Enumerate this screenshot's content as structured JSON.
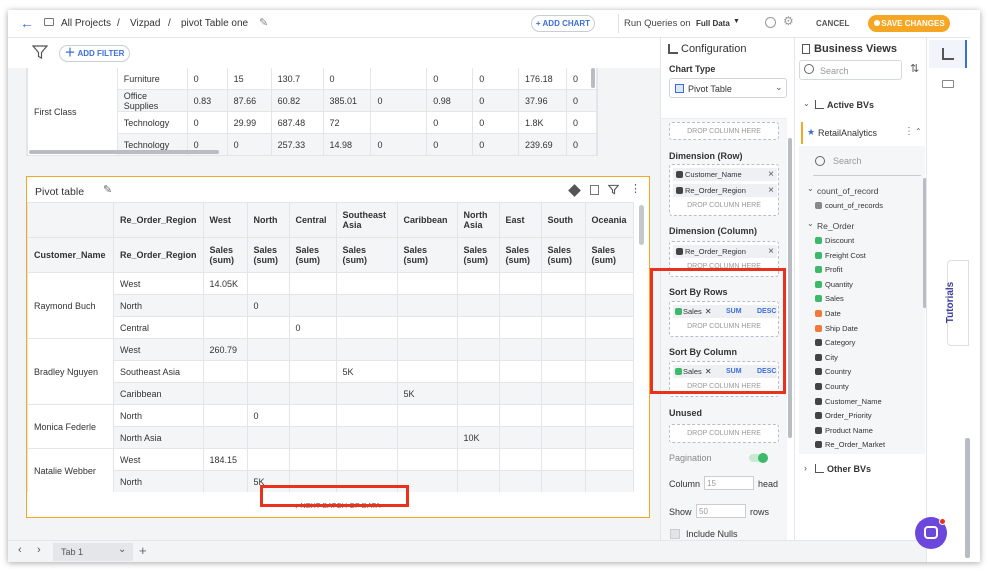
{
  "topbar": {
    "breadcrumb": [
      "All Projects",
      "Vizpad",
      "pivot Table one"
    ],
    "add_chart": "+ ADD CHART",
    "run_queries_label": "Run Queries on",
    "run_queries_value": "Full Data",
    "cancel": "CANCEL",
    "save_changes": "SAVE CHANGES"
  },
  "filterbar": {
    "add_filter": "ADD FILTER"
  },
  "upper_table": {
    "row_group": "First Class",
    "rows": [
      [
        "Furniture",
        "0",
        "15",
        "130.7",
        "0",
        "",
        "0",
        "0",
        "176.18",
        "0"
      ],
      [
        "Office Supplies",
        "0.83",
        "87.66",
        "60.82",
        "385.01",
        "0",
        "0.98",
        "0",
        "37.96",
        "0"
      ],
      [
        "Technology",
        "0",
        "29.99",
        "687.48",
        "72",
        "",
        "0",
        "0",
        "1.8K",
        "0"
      ],
      [
        "Technology",
        "0",
        "0",
        "257.33",
        "14.98",
        "0",
        "0",
        "0",
        "239.69",
        "0"
      ]
    ]
  },
  "pivot": {
    "title": "Pivot table",
    "header_row1": [
      "",
      "Re_Order_Region",
      "West",
      "North",
      "Central",
      "Southeast Asia",
      "Caribbean",
      "North Asia",
      "East",
      "South",
      "Oceania"
    ],
    "header_row2": [
      "Customer_Name",
      "Re_Order_Region",
      "Sales (sum)",
      "Sales (sum)",
      "Sales (sum)",
      "Sales (sum)",
      "Sales (sum)",
      "Sales (sum)",
      "Sales (sum)",
      "Sales (sum)",
      "Sales (sum)"
    ],
    "groups": [
      {
        "name": "Raymond Buch",
        "rows": [
          {
            "region": "West",
            "vals": [
              "14.05K",
              "",
              "",
              "",
              "",
              "",
              "",
              "",
              ""
            ]
          },
          {
            "region": "North",
            "vals": [
              "",
              "0",
              "",
              "",
              "",
              "",
              "",
              "",
              ""
            ]
          },
          {
            "region": "Central",
            "vals": [
              "",
              "",
              "0",
              "",
              "",
              "",
              "",
              "",
              ""
            ]
          }
        ]
      },
      {
        "name": "Bradley Nguyen",
        "rows": [
          {
            "region": "West",
            "vals": [
              "260.79",
              "",
              "",
              "",
              "",
              "",
              "",
              "",
              ""
            ]
          },
          {
            "region": "Southeast Asia",
            "vals": [
              "",
              "",
              "",
              "5K",
              "",
              "",
              "",
              "",
              ""
            ]
          },
          {
            "region": "Caribbean",
            "vals": [
              "",
              "",
              "",
              "",
              "5K",
              "",
              "",
              "",
              ""
            ]
          }
        ]
      },
      {
        "name": "Monica Federle",
        "rows": [
          {
            "region": "North",
            "vals": [
              "",
              "0",
              "",
              "",
              "",
              "",
              "",
              "",
              ""
            ]
          },
          {
            "region": "North Asia",
            "vals": [
              "",
              "",
              "",
              "",
              "",
              "10K",
              "",
              "",
              ""
            ]
          }
        ]
      },
      {
        "name": "Natalie Webber",
        "rows": [
          {
            "region": "West",
            "vals": [
              "184.15",
              "",
              "",
              "",
              "",
              "",
              "",
              "",
              ""
            ]
          },
          {
            "region": "North",
            "vals": [
              "",
              "5K",
              "",
              "",
              "",
              "",
              "",
              "",
              ""
            ]
          }
        ]
      }
    ],
    "next_batch": "↓ NEXT BATCH OF DATA"
  },
  "config": {
    "title": "Configuration",
    "chart_type_label": "Chart Type",
    "chart_type_value": "Pivot Table",
    "drop_column": "DROP COLUMN HERE",
    "dimension_row_label": "Dimension (Row)",
    "dimension_row_chips": [
      "Customer_Name",
      "Re_Order_Region"
    ],
    "dimension_col_label": "Dimension (Column)",
    "dimension_col_chips": [
      "Re_Order_Region"
    ],
    "sort_rows_label": "Sort By Rows",
    "sort_col_label": "Sort By Column",
    "sort_chip": "Sales",
    "sum": "SUM",
    "desc": "DESC",
    "unused_label": "Unused",
    "pagination_label": "Pagination",
    "column_label": "Column",
    "column_value": "15",
    "column_suffix": "head",
    "show_label": "Show",
    "show_value": "50",
    "show_suffix": "rows",
    "include_nulls": "Include Nulls"
  },
  "business_views": {
    "title": "Business Views",
    "search_placeholder": "Search",
    "active_bvs": "Active BVs",
    "bv_name": "RetailAnalytics",
    "inner_search": "Search",
    "group1": "count_of_record",
    "group1_items": [
      "count_of_records"
    ],
    "group2": "Re_Order",
    "group2_items": [
      {
        "name": "Discount",
        "color": "#3cb96a"
      },
      {
        "name": "Freight Cost",
        "color": "#3cb96a"
      },
      {
        "name": "Profit",
        "color": "#3cb96a"
      },
      {
        "name": "Quantity",
        "color": "#3cb96a"
      },
      {
        "name": "Sales",
        "color": "#3cb96a"
      },
      {
        "name": "Date",
        "color": "#f07a3c"
      },
      {
        "name": "Ship Date",
        "color": "#f07a3c"
      },
      {
        "name": "Category",
        "color": "#444444"
      },
      {
        "name": "City",
        "color": "#444444"
      },
      {
        "name": "Country",
        "color": "#444444"
      },
      {
        "name": "County",
        "color": "#444444"
      },
      {
        "name": "Customer_Name",
        "color": "#444444"
      },
      {
        "name": "Order_Priority",
        "color": "#444444"
      },
      {
        "name": "Product Name",
        "color": "#444444"
      },
      {
        "name": "Re_Order_Market",
        "color": "#444444"
      }
    ],
    "other_bvs": "Other BVs"
  },
  "rail": {
    "tutorials": "Tutorials"
  },
  "bottombar": {
    "tab": "Tab 1"
  },
  "colors": {
    "accent": "#3b6fd8",
    "orange": "#f5a623",
    "highlight": "#e8321e"
  }
}
